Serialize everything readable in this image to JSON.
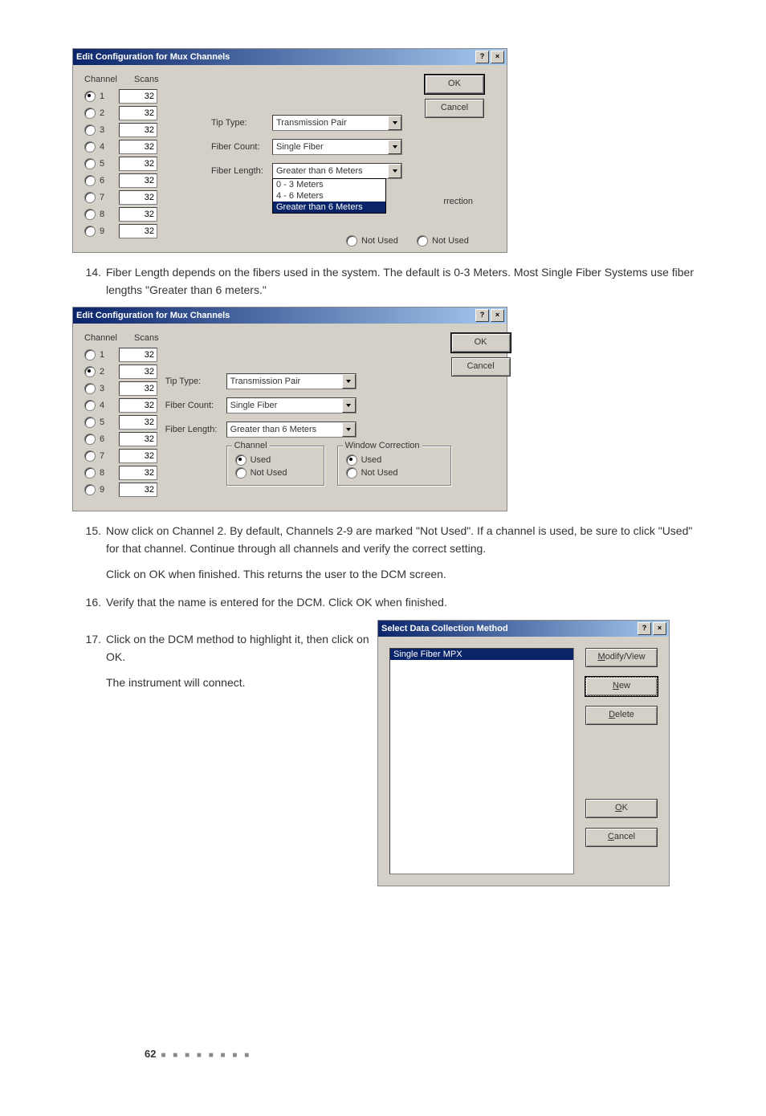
{
  "dialog1": {
    "title": "Edit Configuration for Mux Channels",
    "help": "?",
    "close": "×",
    "headers": {
      "channel": "Channel",
      "scans": "Scans"
    },
    "channels": [
      {
        "n": "1",
        "scans": "32",
        "selected": true
      },
      {
        "n": "2",
        "scans": "32",
        "selected": false
      },
      {
        "n": "3",
        "scans": "32",
        "selected": false
      },
      {
        "n": "4",
        "scans": "32",
        "selected": false
      },
      {
        "n": "5",
        "scans": "32",
        "selected": false
      },
      {
        "n": "6",
        "scans": "32",
        "selected": false
      },
      {
        "n": "7",
        "scans": "32",
        "selected": false
      },
      {
        "n": "8",
        "scans": "32",
        "selected": false
      },
      {
        "n": "9",
        "scans": "32",
        "selected": false
      }
    ],
    "tip_type_label": "Tip Type:",
    "tip_type_value": "Transmission Pair",
    "fiber_count_label": "Fiber Count:",
    "fiber_count_value": "Single Fiber",
    "fiber_length_label": "Fiber Length:",
    "fiber_length_value": "Greater than 6 Meters",
    "fiber_length_options": [
      "0 - 3 Meters",
      "4 - 6 Meters",
      "Greater than 6 Meters"
    ],
    "partial_group": "rrection",
    "not_used1": "Not Used",
    "not_used2": "Not Used",
    "ok": "OK",
    "cancel": "Cancel"
  },
  "step14": {
    "num": "14.",
    "text": "Fiber Length depends on the fibers used in the system. The default is 0-3 Meters. Most Single Fiber Systems use fiber lengths \"Greater than 6 meters.\""
  },
  "dialog2": {
    "title": "Edit Configuration for Mux Channels",
    "help": "?",
    "close": "×",
    "headers": {
      "channel": "Channel",
      "scans": "Scans"
    },
    "channels": [
      {
        "n": "1",
        "scans": "32",
        "selected": false
      },
      {
        "n": "2",
        "scans": "32",
        "selected": true
      },
      {
        "n": "3",
        "scans": "32",
        "selected": false
      },
      {
        "n": "4",
        "scans": "32",
        "selected": false
      },
      {
        "n": "5",
        "scans": "32",
        "selected": false
      },
      {
        "n": "6",
        "scans": "32",
        "selected": false
      },
      {
        "n": "7",
        "scans": "32",
        "selected": false
      },
      {
        "n": "8",
        "scans": "32",
        "selected": false
      },
      {
        "n": "9",
        "scans": "32",
        "selected": false
      }
    ],
    "tip_type_label": "Tip Type:",
    "tip_type_value": "Transmission Pair",
    "fiber_count_label": "Fiber Count:",
    "fiber_count_value": "Single Fiber",
    "fiber_length_label": "Fiber Length:",
    "fiber_length_value": "Greater than 6 Meters",
    "channel_group": "Channel",
    "window_group": "Window Correction",
    "used": "Used",
    "not_used": "Not Used",
    "ok": "OK",
    "cancel": "Cancel"
  },
  "step15": {
    "num": "15.",
    "text": "Now click on Channel 2. By default, Channels 2-9 are marked \"Not Used\". If a channel is used, be sure to click \"Used\" for that channel. Continue through all channels and verify the correct setting.",
    "para": "Click on OK when finished. This returns the user to the DCM screen."
  },
  "step16": {
    "num": "16.",
    "text": "Verify that the name is entered for the DCM. Click OK when finished."
  },
  "step17": {
    "num": "17.",
    "text": "Click on the DCM method to highlight it, then click on OK.",
    "para": "The instrument will connect."
  },
  "select_dialog": {
    "title": "Select Data Collection Method",
    "help": "?",
    "close": "×",
    "item": "Single Fiber MPX",
    "modify": "Modify/View",
    "new": "New",
    "delete": "Delete",
    "ok": "OK",
    "cancel": "Cancel"
  },
  "footer": {
    "page": "62"
  }
}
